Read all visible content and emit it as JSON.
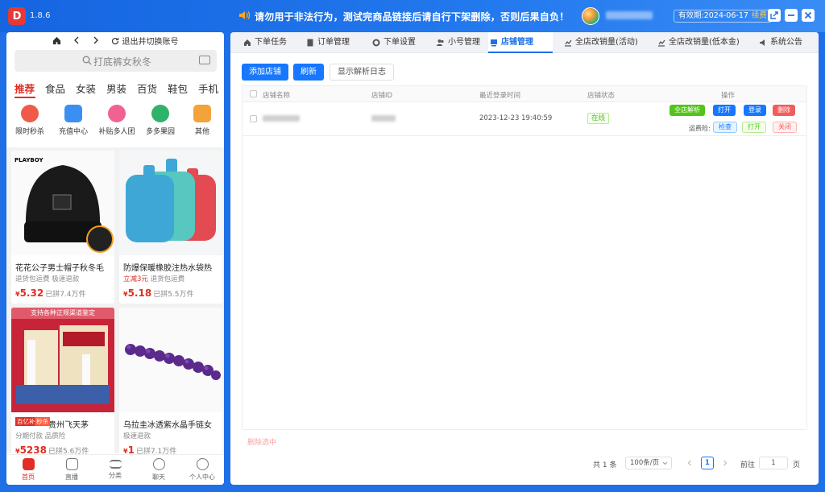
{
  "app": {
    "version": "1.8.6",
    "notice": "请勿用于非法行为，测试完商品链接后请自行下架删除，否则后果自负！",
    "expiry_label": "有效期:",
    "expiry_date": "2024-06-17",
    "renew_label": "续费"
  },
  "phone": {
    "nav": {
      "home_icon": "home-icon",
      "switch_label": "退出并切换账号"
    },
    "search_placeholder": "打底裤女秋冬",
    "categories": [
      "推荐",
      "食品",
      "女装",
      "男装",
      "百货",
      "鞋包",
      "手机"
    ],
    "icons": [
      {
        "label": "限时秒杀",
        "color": "#f05a4a",
        "icon": "alarm-clock-icon"
      },
      {
        "label": "充值中心",
        "color": "#3b8ff3",
        "icon": "recharge-icon"
      },
      {
        "label": "补贴多人团",
        "color": "#f06292",
        "icon": "flower-icon"
      },
      {
        "label": "多多果园",
        "color": "#2fb36a",
        "icon": "tree-icon"
      },
      {
        "label": "其他",
        "color": "#f4a23a",
        "icon": "grid-icon"
      }
    ],
    "products": [
      {
        "name": "花花公子男士帽子秋冬毛",
        "tags": "退货包运费  极速退款",
        "tag_red": "",
        "price": "5.32",
        "sold": "已拼7.4万件"
      },
      {
        "name": "防爆保暖橡胶注热水袋热",
        "tags": "退货包运费",
        "tag_red": "立减3元",
        "price": "5.18",
        "sold": "已拼5.5万件"
      },
      {
        "name": "贵州飞天茅",
        "tags": "分期付款  品质险",
        "tag_red": "",
        "price": "5238",
        "sold": "已拼5.6万件",
        "badge1": "百亿补贴",
        "badge2": "秒杀",
        "banner": "支持各种正规渠道鉴定"
      },
      {
        "name": "乌拉圭冰透紫水晶手链女",
        "tags": "极速退款",
        "tag_red": "",
        "price": "1",
        "sold": "已拼7.1万件"
      }
    ],
    "tabbar": [
      "首页",
      "直播",
      "分类",
      "聊天",
      "个人中心"
    ]
  },
  "main": {
    "tabs": [
      "下单任务",
      "订单管理",
      "下单设置",
      "小号管理",
      "店铺管理",
      "全店改销量(活动)",
      "全店改销量(低本金)",
      "系统公告"
    ],
    "active_tab": "店铺管理",
    "buttons": {
      "add": "添加店铺",
      "refresh": "刷新",
      "log": "显示解析日志"
    },
    "table": {
      "headers": [
        "店铺名称",
        "店铺ID",
        "最近登录时间",
        "店铺状态",
        "操作"
      ],
      "rows": [
        {
          "last_login": "2023-12-23 19:40:59",
          "status": "在线",
          "ops": [
            "全店解析",
            "打开",
            "登录",
            "删除"
          ],
          "freight_label": "运费险:",
          "freight_ops": [
            "检查",
            "打开",
            "关闭"
          ]
        }
      ]
    },
    "bulk_delete": "删除选中",
    "pagination": {
      "total": "共 1 条",
      "page_size": "100条/页",
      "current_page": "1",
      "goto_label": "前往",
      "goto_value": "1",
      "page_unit": "页"
    }
  }
}
